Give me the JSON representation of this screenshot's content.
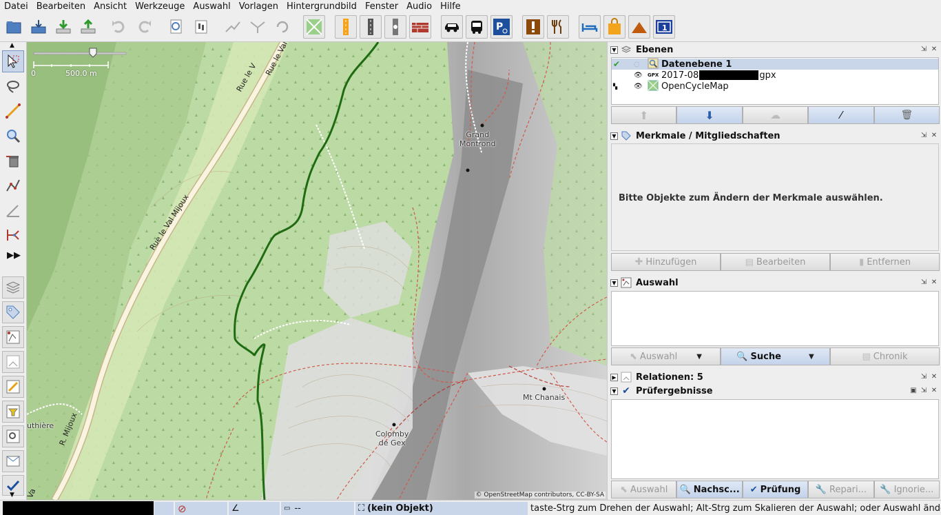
{
  "menu": [
    "Datei",
    "Bearbeiten",
    "Ansicht",
    "Werkzeuge",
    "Auswahl",
    "Vorlagen",
    "Hintergrundbild",
    "Fenster",
    "Audio",
    "Hilfe"
  ],
  "map": {
    "scale_zero": "0",
    "scale_value": "500.0 m",
    "labels": {
      "grand_montrond": "Grand\nMontrond",
      "mt_chanais": "Mt Chanais",
      "colomby": "Colomby\nde Gex",
      "uthiere": "uthière",
      "road1": "Rue le Val Mijoux",
      "road2": "Rue le V",
      "road3": "Rue le Val Mijoux",
      "road4": "R. Mijoux",
      "road5": "Va"
    },
    "attribution": "© OpenStreetMap contributors, CC-BY-SA"
  },
  "panels": {
    "layers": {
      "title": "Ebenen",
      "items": [
        {
          "name": "Datenebene 1",
          "badge": ""
        },
        {
          "name": "2017-08",
          "suffix": "gpx",
          "badge": "GPX"
        },
        {
          "name": "OpenCycleMap",
          "badge": ""
        }
      ]
    },
    "tags": {
      "title": "Merkmale / Mitgliedschaften",
      "empty_message": "Bitte Objekte zum Ändern der Merkmale auswählen.",
      "buttons": [
        "Hinzufügen",
        "Bearbeiten",
        "Entfernen"
      ]
    },
    "selection": {
      "title": "Auswahl",
      "buttons": [
        "Auswahl",
        "Suche",
        "Chronik"
      ]
    },
    "relations": {
      "title": "Relationen: 5"
    },
    "validation": {
      "title": "Prüfergebnisse",
      "buttons": [
        "Auswahl",
        "Nachsc...",
        "Prüfung",
        "Repari...",
        "Ignorie..."
      ]
    }
  },
  "status": {
    "distance": "--",
    "object": "(kein Objekt)",
    "help": "taste-Strg zum Drehen der Auswahl; Alt-Strg zum Skalieren der Auswahl; oder Auswahl ändern"
  },
  "colors": {
    "accent": "#c9d6ea",
    "track": "#1f6b12",
    "forest": "#bfdca6",
    "rock": "#9a9a9a"
  }
}
